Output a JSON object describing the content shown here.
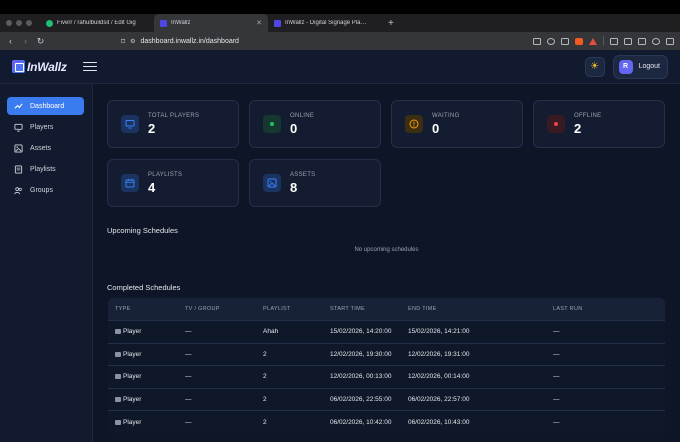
{
  "browser": {
    "tabs": [
      {
        "label": "Fiverr / rahulbuildsit / Edit Gig",
        "active": false,
        "favicon_color": "#1dbf73"
      },
      {
        "label": "InWallz",
        "active": true,
        "favicon_color": "#4f46e5"
      },
      {
        "label": "InWallz - Digital Signage Platform",
        "active": false,
        "favicon_color": "#4f46e5"
      }
    ],
    "new_tab_label": "+",
    "url": "dashboard.inwallz.in/dashboard"
  },
  "header": {
    "logo_text": "InWallz",
    "theme_icon": "sun-icon",
    "user_initial": "R",
    "logout_label": "Logout"
  },
  "sidebar": {
    "items": [
      {
        "label": "Dashboard",
        "icon": "trend-icon",
        "active": true
      },
      {
        "label": "Players",
        "icon": "monitor-icon",
        "active": false
      },
      {
        "label": "Assets",
        "icon": "image-icon",
        "active": false
      },
      {
        "label": "Playlists",
        "icon": "list-icon",
        "active": false
      },
      {
        "label": "Groups",
        "icon": "users-icon",
        "active": false
      }
    ]
  },
  "stats": [
    {
      "label": "TOTAL PLAYERS",
      "value": "2",
      "icon": "monitor-icon",
      "color": "#3b82f6"
    },
    {
      "label": "ONLINE",
      "value": "0",
      "icon": "dot-icon",
      "color": "#22c55e"
    },
    {
      "label": "WAITING",
      "value": "0",
      "icon": "alert-icon",
      "color": "#f59e0b"
    },
    {
      "label": "OFFLINE",
      "value": "2",
      "icon": "dot-icon",
      "color": "#ef4444"
    },
    {
      "label": "PLAYLISTS",
      "value": "4",
      "icon": "calendar-icon",
      "color": "#3b82f6"
    },
    {
      "label": "ASSETS",
      "value": "8",
      "icon": "image-icon",
      "color": "#3b82f6"
    }
  ],
  "upcoming": {
    "title": "Upcoming Schedules",
    "empty_text": "No upcoming schedules"
  },
  "completed": {
    "title": "Completed Schedules",
    "columns": [
      "TYPE",
      "TV / GROUP",
      "PLAYLIST",
      "START TIME",
      "END TIME",
      "LAST RUN"
    ],
    "rows": [
      [
        "Player",
        "—",
        "Ahah",
        "15/02/2026, 14:20:00",
        "15/02/2026, 14:21:00",
        "—"
      ],
      [
        "Player",
        "—",
        "2",
        "12/02/2026, 19:30:00",
        "12/02/2026, 19:31:00",
        "—"
      ],
      [
        "Player",
        "—",
        "2",
        "12/02/2026, 00:13:00",
        "12/02/2026, 00:14:00",
        "—"
      ],
      [
        "Player",
        "—",
        "2",
        "06/02/2026, 22:55:00",
        "06/02/2026, 22:57:00",
        "—"
      ],
      [
        "Player",
        "—",
        "2",
        "06/02/2026, 10:42:00",
        "06/02/2026, 10:43:00",
        "—"
      ]
    ]
  }
}
